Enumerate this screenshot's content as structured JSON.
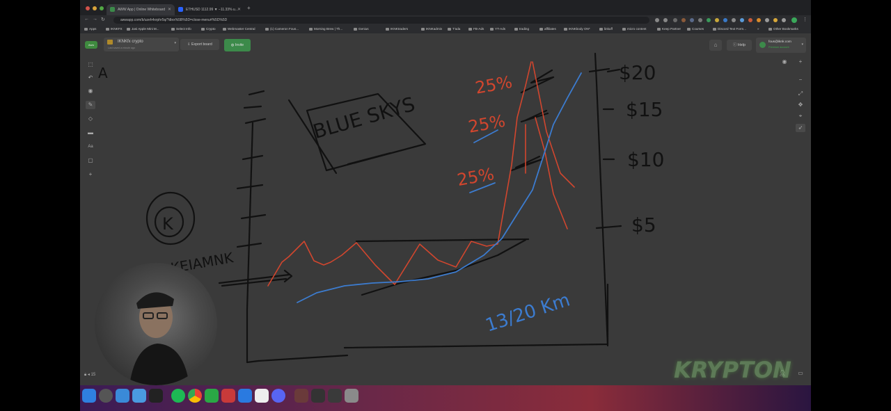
{
  "browser": {
    "tabs": [
      {
        "title": "AWW App | Online Whiteboard",
        "active": true
      },
      {
        "title": "ETHUSD 1112.99 ▼ −11.33% u...",
        "active": false
      }
    ],
    "url": "awwapp.com/b/uzeh4xrphr5q/?dlex%5B%5D=close-menu#%5D%5D",
    "bookmarks": [
      "Apps",
      "IKNKFX",
      "Jasi Apple Mini M...",
      "Select Info",
      "Crypto",
      "Webmaster Central",
      "(1) Cameron Fous...",
      "Morning Brew | Th...",
      "Genius",
      "IKNKtraders",
      "IKNKadmin",
      "T'ada",
      "FB-Ads",
      "YT-Ads",
      "trading",
      "affiliates",
      "IKNKbody ON*",
      "linkuff",
      "micro content",
      "Keep Partner",
      "Courses",
      "Discord Text Form...",
      "»",
      "Other Bookmarks"
    ]
  },
  "app": {
    "logo_text": "Aww",
    "board_name": "IKNKfx crypto",
    "board_subtitle": "Last saved a minute ago",
    "export_label": "Export board",
    "invite_label": "Invite",
    "help_label": "Help",
    "account_email": "fous@iknk.com",
    "account_plan": "Premium account",
    "page_number": "15"
  },
  "whiteboard": {
    "handwriting": {
      "corner_letter": "A",
      "blue_sky": "BLUE SKYS",
      "brand_name": "KEIAMNK",
      "logo_letter": "K",
      "date_note": "13/20 Km",
      "percent_labels": [
        "25%",
        "25%",
        "25%"
      ],
      "price_levels": [
        "$20",
        "$15",
        "$10",
        "$5"
      ]
    },
    "pen_colors": {
      "black": "#111111",
      "red": "#d2462e",
      "blue": "#3c7cd0"
    }
  },
  "overlay": {
    "brand_watermark": "KRYPTON"
  },
  "dock": {
    "apps": [
      "finder-icon",
      "launchpad-icon",
      "safari-icon",
      "mail-icon",
      "terminal-icon",
      "spotify-icon",
      "chrome-icon",
      "camtasia-icon",
      "parallels-icon",
      "folder-icon",
      "photos-icon",
      "discord-icon",
      "gallery-icon",
      "video-icon",
      "notes-icon",
      "trash-icon"
    ]
  }
}
